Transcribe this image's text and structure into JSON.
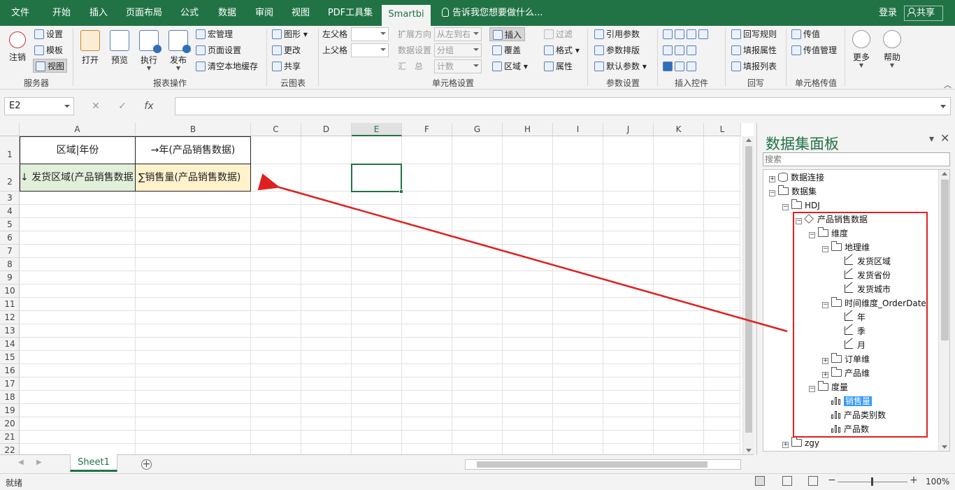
{
  "tabs": [
    "文件",
    "开始",
    "插入",
    "页面布局",
    "公式",
    "数据",
    "审阅",
    "视图",
    "PDF工具集",
    "Smartbi"
  ],
  "active_tab": "Smartbi",
  "tell_me": "告诉我您想要做什么...",
  "login": "登录",
  "share": "共享",
  "ribbon": {
    "server": {
      "logout": "注销",
      "settings": "设置",
      "template": "模板",
      "view": "视图",
      "label": "服务器"
    },
    "report": {
      "open": "打开",
      "preview": "预览",
      "execute": "执行",
      "publish": "发布",
      "macro": "宏管理",
      "page_setup": "页面设置",
      "clear_cache": "清空本地缓存",
      "label": "报表操作"
    },
    "cloud": {
      "chart": "图形",
      "update": "更改",
      "share": "共享",
      "label": "云图表"
    },
    "cell": {
      "left_parent": "左父格",
      "top_parent": "上父格",
      "expand_dir": "扩展方向",
      "expand_val": "从左到右",
      "data_setting": "数据设置",
      "data_val": "分组",
      "summary": "汇　总",
      "summary_val": "计数",
      "insert": "插入",
      "cover": "覆盖",
      "region": "区域",
      "filter": "过滤",
      "format": "格式",
      "property": "属性",
      "label": "单元格设置"
    },
    "param": {
      "ref": "引用参数",
      "layout": "参数排版",
      "default": "默认参数",
      "label": "参数设置"
    },
    "insert_ctrl": {
      "label": "插入控件"
    },
    "writeback": {
      "rule": "回写规则",
      "fill_prop": "填报属性",
      "fill_list": "填报列表",
      "label": "回写"
    },
    "pass": {
      "pass_val": "传值",
      "pass_mgr": "传值管理",
      "label": "单元格传值"
    },
    "more": "更多",
    "help": "帮助"
  },
  "namebox": "E2",
  "columns": [
    "A",
    "B",
    "C",
    "D",
    "E",
    "F",
    "G",
    "H",
    "I",
    "J",
    "K",
    "L"
  ],
  "rows": [
    "1",
    "2",
    "3",
    "4",
    "5",
    "6",
    "7",
    "8",
    "9",
    "10",
    "11",
    "12",
    "13",
    "14",
    "15",
    "16",
    "17",
    "18",
    "19",
    "20",
    "21",
    "22"
  ],
  "cells": {
    "a1": "区域|年份",
    "b1": "→年(产品销售数据)",
    "a2": "↓ 发货区域(产品销售数据",
    "b2": "∑销售量(产品销售数据)"
  },
  "sheet_tab": "Sheet1",
  "status": "就绪",
  "zoom": "100%",
  "panel": {
    "title": "数据集面板",
    "search_placeholder": "搜索",
    "tree": {
      "conn": "数据连接",
      "dataset": "数据集",
      "hdj": "HDJ",
      "product_sales": "产品销售数据",
      "dimension": "维度",
      "geo": "地理维",
      "ship_region": "发货区域",
      "ship_province": "发货省份",
      "ship_city": "发货城市",
      "time": "时间维度_OrderDate",
      "year": "年",
      "quarter": "季",
      "month": "月",
      "order": "订单维",
      "product": "产品维",
      "measure": "度量",
      "sales_qty": "销售量",
      "product_cat_count": "产品类别数",
      "product_count": "产品数",
      "zgy": "zgy"
    }
  },
  "colors": {
    "excel_green": "#217346",
    "highlight_red": "#e02020",
    "header_fill": "#fff2cc",
    "dim_fill": "#e2efda"
  }
}
